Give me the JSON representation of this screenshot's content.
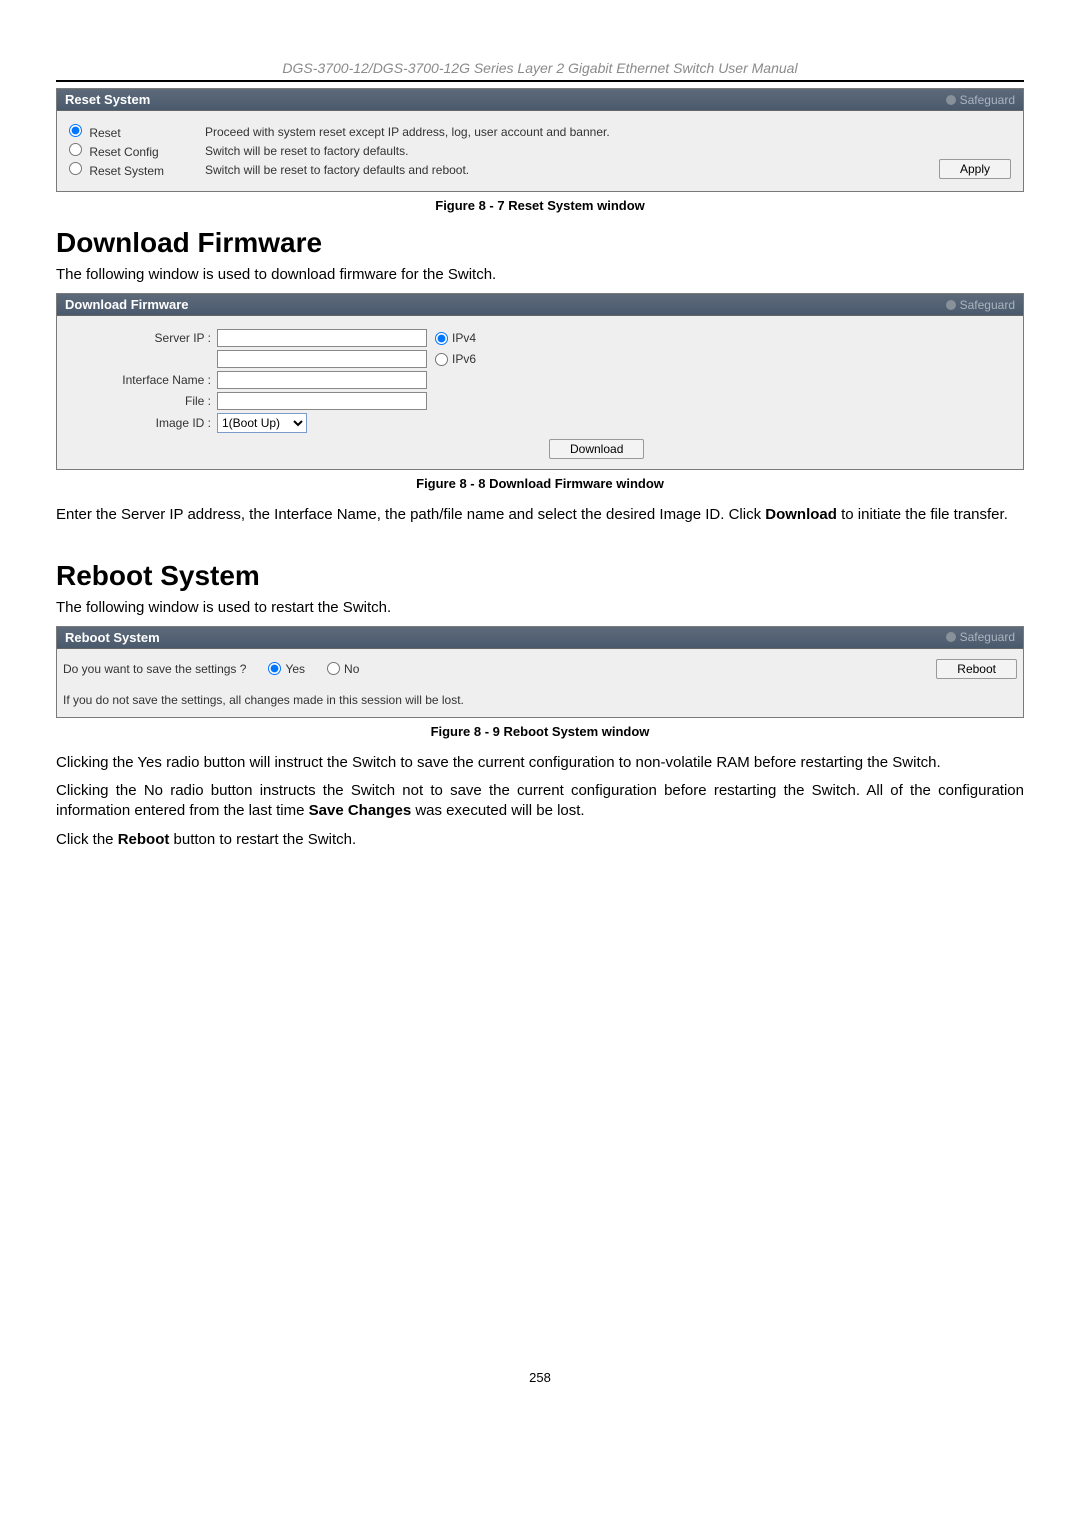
{
  "manual_header": "DGS-3700-12/DGS-3700-12G Series Layer 2 Gigabit Ethernet Switch User Manual",
  "panel_reset": {
    "title": "Reset System",
    "safeguard": "Safeguard",
    "options": [
      {
        "label": "Reset",
        "desc": "Proceed with system reset except IP address, log, user account and banner."
      },
      {
        "label": "Reset Config",
        "desc": "Switch will be reset to factory defaults."
      },
      {
        "label": "Reset System",
        "desc": "Switch will be reset to factory defaults and reboot."
      }
    ],
    "apply_btn": "Apply"
  },
  "fig7": "Figure 8 - 7 Reset System window",
  "section_download": {
    "heading": "Download Firmware",
    "intro": "The following window is used to download firmware for the Switch."
  },
  "panel_download": {
    "title": "Download Firmware",
    "safeguard": "Safeguard",
    "labels": {
      "server_ip": "Server IP :",
      "interface": "Interface Name :",
      "file": "File :",
      "image_id": "Image ID :"
    },
    "ipv4": "IPv4",
    "ipv6": "IPv6",
    "image_option": "1(Boot Up)",
    "download_btn": "Download"
  },
  "fig8": "Figure 8 - 8 Download Firmware window",
  "download_desc_1a": "Enter the Server IP address, the Interface Name, the path/file name and select the desired Image ID. Click ",
  "download_desc_bold": "Download",
  "download_desc_1b": " to initiate the file transfer.",
  "section_reboot": {
    "heading": "Reboot System",
    "intro": "The following window is used to restart the Switch."
  },
  "panel_reboot": {
    "title": "Reboot System",
    "safeguard": "Safeguard",
    "question": "Do you want to save the settings ?",
    "yes": "Yes",
    "no": "No",
    "reboot_btn": "Reboot",
    "warning": "If you do not save the settings, all changes made in this session will be lost."
  },
  "fig9": "Figure 8 - 9 Reboot System window",
  "reboot_p1": "Clicking the Yes radio button will instruct the Switch to save the current configuration to non-volatile RAM before restarting the Switch.",
  "reboot_p2a": "Clicking the No radio button instructs the Switch not to save the current configuration before restarting the Switch. All of the configuration information entered from the last time ",
  "reboot_p2_bold": "Save Changes",
  "reboot_p2b": " was executed will be lost.",
  "reboot_p3a": "Click the ",
  "reboot_p3_bold": "Reboot",
  "reboot_p3b": " button to restart the Switch.",
  "page_number": "258"
}
